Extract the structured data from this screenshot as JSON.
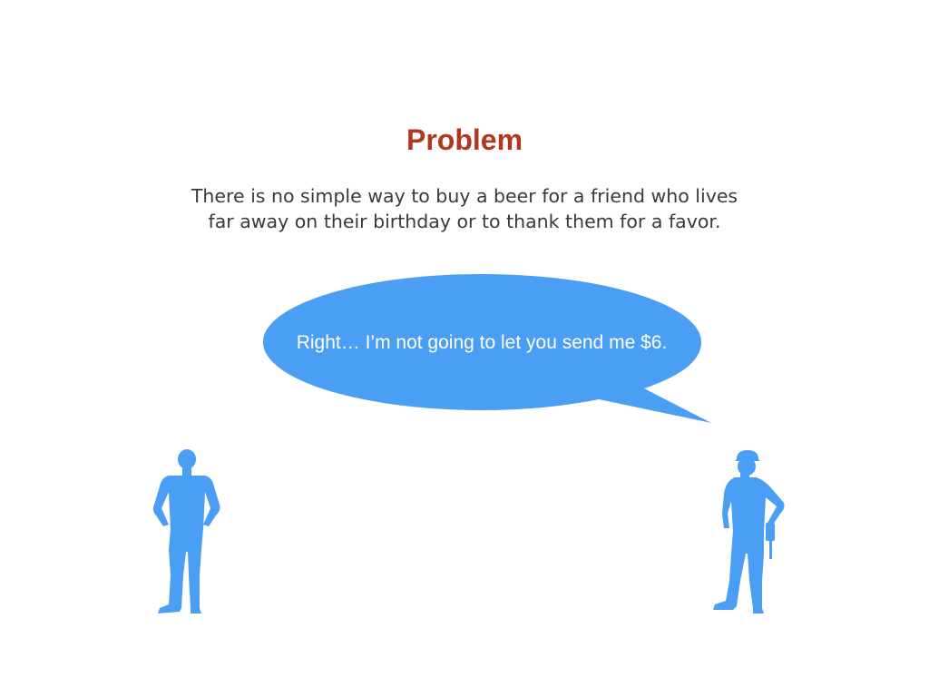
{
  "slide": {
    "title": "Problem",
    "description_line1": "There is no simple way to buy a beer for a friend who lives",
    "description_line2": "far away on their birthday or to thank them for a favor.",
    "speech_bubble_text": "Right… I’m not going to let you send me $6."
  },
  "colors": {
    "title": "#b5361f",
    "body_text": "#3a3a3a",
    "accent_blue": "#4a9ff5",
    "bubble_text": "#ffffff"
  },
  "icons": {
    "left_figure": "man-standing-hands-on-hips-icon",
    "right_figure": "worker-with-hard-hat-and-tool-belt-icon"
  }
}
